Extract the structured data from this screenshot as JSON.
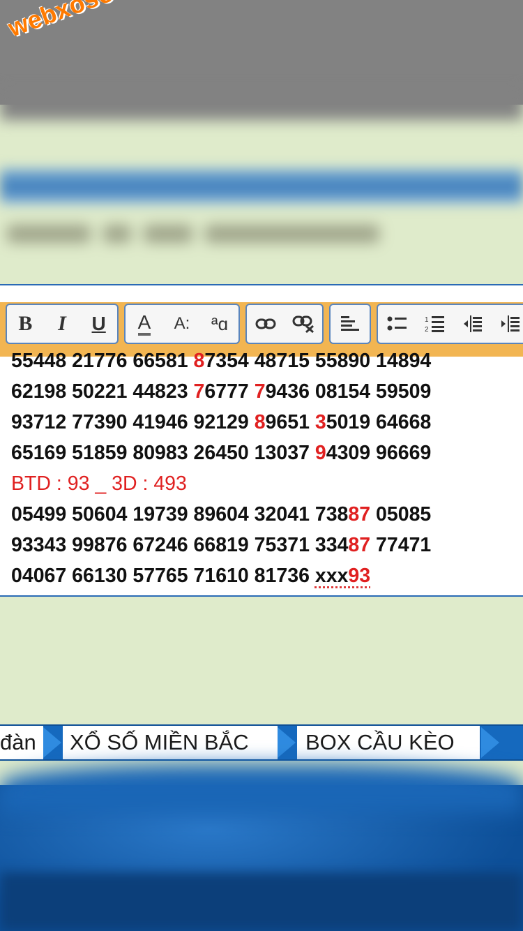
{
  "watermark": "webxoso.net",
  "toolbar": {
    "groups": [
      [
        "bold-icon",
        "italic-icon",
        "underline-icon"
      ],
      [
        "text-color-icon",
        "font-size-icon",
        "font-family-icon"
      ],
      [
        "link-icon",
        "unlink-icon"
      ],
      [
        "align-left-icon"
      ],
      [
        "bullet-list-icon",
        "numbered-list-icon",
        "outdent-icon",
        "indent-icon"
      ]
    ],
    "bold_label": "B",
    "italic_label": "I",
    "underline_label": "U",
    "text_color_label": "A",
    "font_size_label": "A:",
    "font_family_label": "ªɑ"
  },
  "content": {
    "lines": [
      [
        {
          "t": "55448 21776 66581 "
        },
        {
          "t": "8",
          "red": true
        },
        {
          "t": "7354 48715 55890 14894"
        }
      ],
      [
        {
          "t": "62198 50221 44823 "
        },
        {
          "t": "7",
          "red": true
        },
        {
          "t": "6777 "
        },
        {
          "t": "7",
          "red": true
        },
        {
          "t": "9436 08154 59509"
        }
      ],
      [
        {
          "t": "93712 77390 41946 92129 "
        },
        {
          "t": "8",
          "red": true
        },
        {
          "t": "9651 "
        },
        {
          "t": "3",
          "red": true
        },
        {
          "t": "5019 64668"
        }
      ],
      [
        {
          "t": "65169 51859 80983 26450 13037 "
        },
        {
          "t": "9",
          "red": true
        },
        {
          "t": "4309 96669"
        }
      ],
      [
        {
          "t": "BTD : 93 _ 3D : 493",
          "btd": true
        }
      ],
      [
        {
          "t": "05499 50604 19739 89604 32041 738"
        },
        {
          "t": "87",
          "red": true
        },
        {
          "t": " 05085"
        }
      ],
      [
        {
          "t": "93343 99876 67246 66819 75371 334"
        },
        {
          "t": "87",
          "red": true
        },
        {
          "t": " 77471"
        }
      ],
      [
        {
          "t": "04067 66130 57765 71610 81736 "
        },
        {
          "t": "xxx",
          "spell": true
        },
        {
          "t": "93",
          "red": true,
          "spell": true
        }
      ]
    ]
  },
  "nav": {
    "item1": "đàn",
    "item2": "XỔ SỐ MIỀN BẮC",
    "item3": "BOX CẦU KÈO"
  },
  "colors": {
    "accent_red": "#e02020",
    "toolbar_orange": "#f2b552",
    "nav_blue": "#1569be",
    "background": "#dfebcb"
  }
}
